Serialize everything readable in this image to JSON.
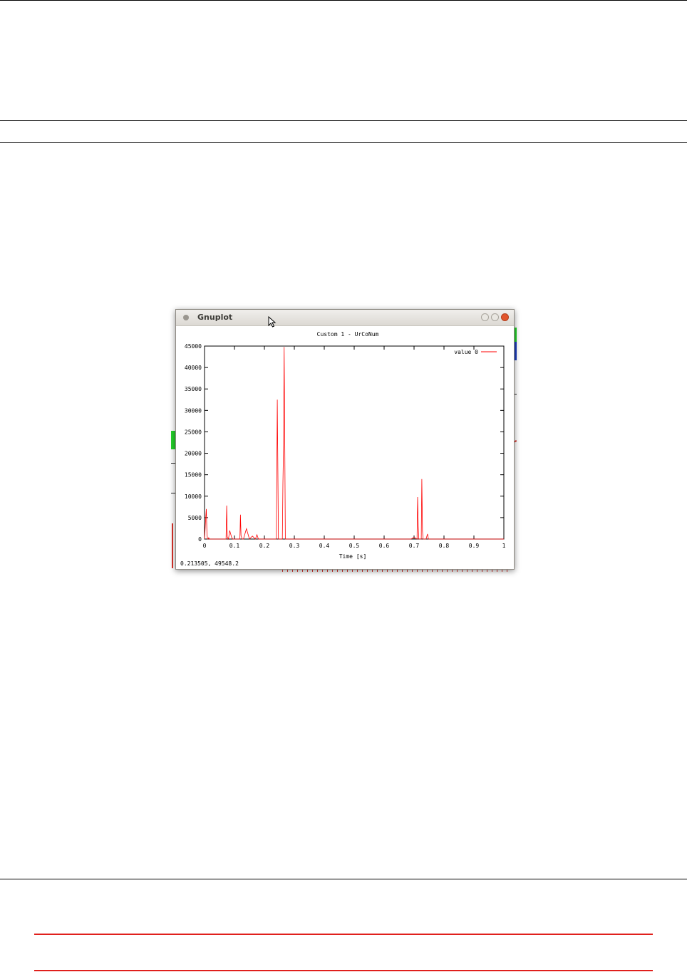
{
  "window": {
    "title": "Gnuplot",
    "status_coordinates": "0.213505,  49548.2"
  },
  "chart_data": {
    "type": "line",
    "title": "Custom 1 - UrCoNum",
    "xlabel": "Time [s]",
    "ylabel": "",
    "xlim": [
      0,
      1
    ],
    "ylim": [
      0,
      45000
    ],
    "x_ticks": [
      "0",
      "0.1",
      "0.2",
      "0.3",
      "0.4",
      "0.5",
      "0.6",
      "0.7",
      "0.8",
      "0.9",
      "1"
    ],
    "y_ticks": [
      "0",
      "5000",
      "10000",
      "15000",
      "20000",
      "25000",
      "30000",
      "35000",
      "40000",
      "45000"
    ],
    "legend": "top-right",
    "series": [
      {
        "name": "value 0",
        "color": "#ff0000",
        "x": [
          0,
          0.004,
          0.006,
          0.008,
          0.01,
          0.012,
          0.014,
          0.016,
          0.02,
          0.04,
          0.06,
          0.072,
          0.074,
          0.076,
          0.08,
          0.084,
          0.088,
          0.09,
          0.094,
          0.1,
          0.11,
          0.118,
          0.12,
          0.122,
          0.126,
          0.13,
          0.14,
          0.15,
          0.16,
          0.17,
          0.175,
          0.18,
          0.2,
          0.24,
          0.243,
          0.245,
          0.247,
          0.25,
          0.255,
          0.26,
          0.262,
          0.264,
          0.266,
          0.268,
          0.27,
          0.272,
          0.275,
          0.28,
          0.35,
          0.5,
          0.65,
          0.69,
          0.7,
          0.71,
          0.712,
          0.714,
          0.716,
          0.72,
          0.724,
          0.726,
          0.728,
          0.73,
          0.735,
          0.74,
          0.745,
          0.748,
          0.75,
          0.8,
          1.0
        ],
        "values": [
          0,
          5000,
          7000,
          1200,
          0,
          0,
          300,
          0,
          0,
          0,
          0,
          0,
          7800,
          500,
          0,
          2000,
          1000,
          500,
          0,
          0,
          0,
          0,
          5700,
          800,
          0,
          0,
          2400,
          0,
          700,
          0,
          1000,
          0,
          0,
          0,
          32500,
          16000,
          0,
          0,
          0,
          0,
          13000,
          22000,
          44800,
          22000,
          0,
          0,
          0,
          0,
          0,
          0,
          0,
          0,
          400,
          0,
          9800,
          3000,
          0,
          0,
          0,
          14000,
          2000,
          0,
          0,
          0,
          1200,
          0,
          0,
          0,
          0
        ]
      }
    ]
  }
}
